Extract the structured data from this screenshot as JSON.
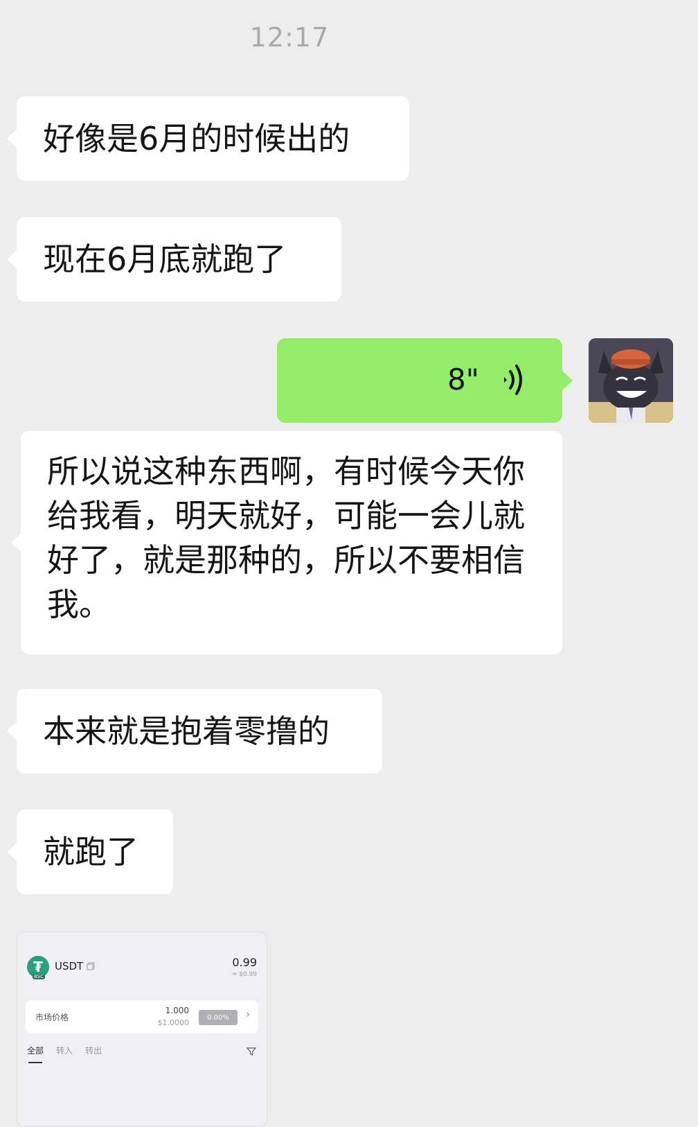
{
  "timestamp": "12:17",
  "messages": [
    {
      "side": "left",
      "text": "好像是6月的时候出的"
    },
    {
      "side": "left",
      "text": "现在6月底就跑了"
    },
    {
      "side": "right",
      "type": "voice",
      "duration": "8\""
    },
    {
      "side": "left",
      "text": "所以说这种东西啊，有时候今天你给我看，明天就好，可能一会儿就好了，就是那种的，所以不要相信我。"
    },
    {
      "side": "left",
      "text": "本来就是抱着零撸的"
    },
    {
      "side": "left",
      "text": "就跑了"
    }
  ],
  "wallet_card": {
    "coin": "USDT",
    "chain_badge": "BSC",
    "balance": "0.99",
    "balance_usd": "≈ $0.99",
    "market_label": "市场价格",
    "market_price": "1.000",
    "market_usd": "$1.0000",
    "change": "0.00%",
    "tabs": [
      "全部",
      "转入",
      "转出"
    ]
  },
  "colors": {
    "background": "#ededed",
    "incoming_bubble": "#ffffff",
    "outgoing_bubble": "#95ec69",
    "tether_green": "#26a17b"
  }
}
